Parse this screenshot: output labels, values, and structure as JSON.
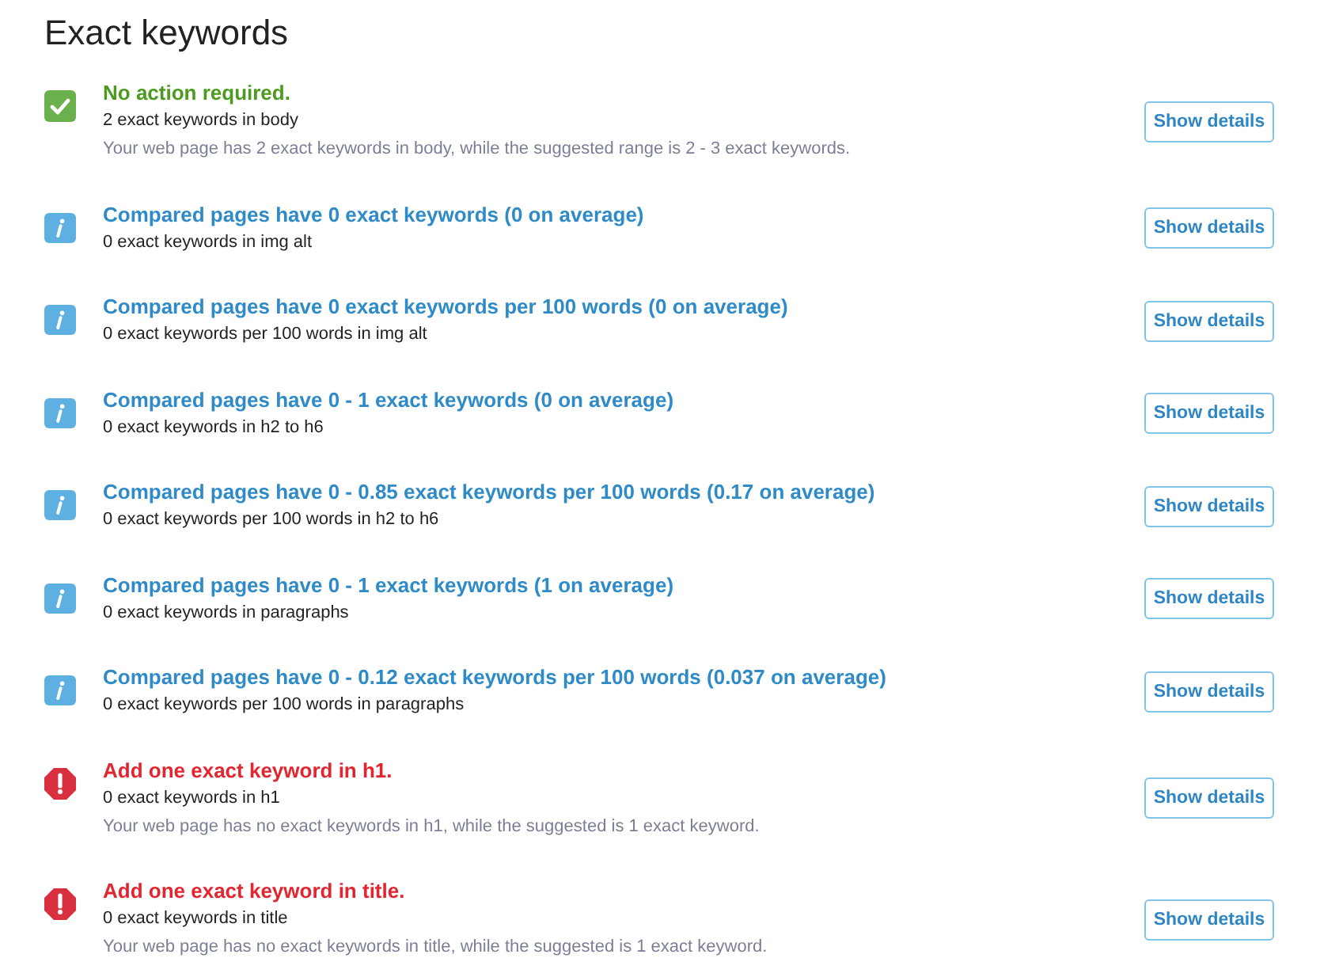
{
  "heading": "Exact keywords",
  "items": [
    {
      "kind": "success",
      "title": "No action required.",
      "summary": "2 exact keywords in body",
      "description": "Your web page has 2 exact keywords in body, while the suggested range is 2 - 3 exact keywords.",
      "button": "Show details"
    },
    {
      "kind": "info",
      "title": "Compared pages have 0 exact keywords (0 on average)",
      "summary": "0 exact keywords in img alt",
      "button": "Show details"
    },
    {
      "kind": "info",
      "title": "Compared pages have 0 exact keywords per 100 words (0 on average)",
      "summary": "0 exact keywords per 100 words in img alt",
      "button": "Show details"
    },
    {
      "kind": "info",
      "title": "Compared pages have 0 - 1 exact keywords (0 on average)",
      "summary": "0 exact keywords in h2 to h6",
      "button": "Show details"
    },
    {
      "kind": "info",
      "title": "Compared pages have 0 - 0.85 exact keywords per 100 words (0.17 on average)",
      "summary": "0 exact keywords per 100 words in h2 to h6",
      "button": "Show details"
    },
    {
      "kind": "info",
      "title": "Compared pages have 0 - 1 exact keywords (1 on average)",
      "summary": "0 exact keywords in paragraphs",
      "button": "Show details"
    },
    {
      "kind": "info",
      "title": "Compared pages have 0 - 0.12 exact keywords per 100 words (0.037 on average)",
      "summary": "0 exact keywords per 100 words in paragraphs",
      "button": "Show details"
    },
    {
      "kind": "error",
      "title": "Add one exact keyword in h1.",
      "summary": "0 exact keywords in h1",
      "description": "Your web page has no exact keywords in h1, while the suggested is 1 exact keyword.",
      "button": "Show details"
    },
    {
      "kind": "error",
      "title": "Add one exact keyword in title.",
      "summary": "0 exact keywords in title",
      "description": "Your web page has no exact keywords in title, while the suggested is 1 exact keyword.",
      "button": "Show details"
    }
  ]
}
